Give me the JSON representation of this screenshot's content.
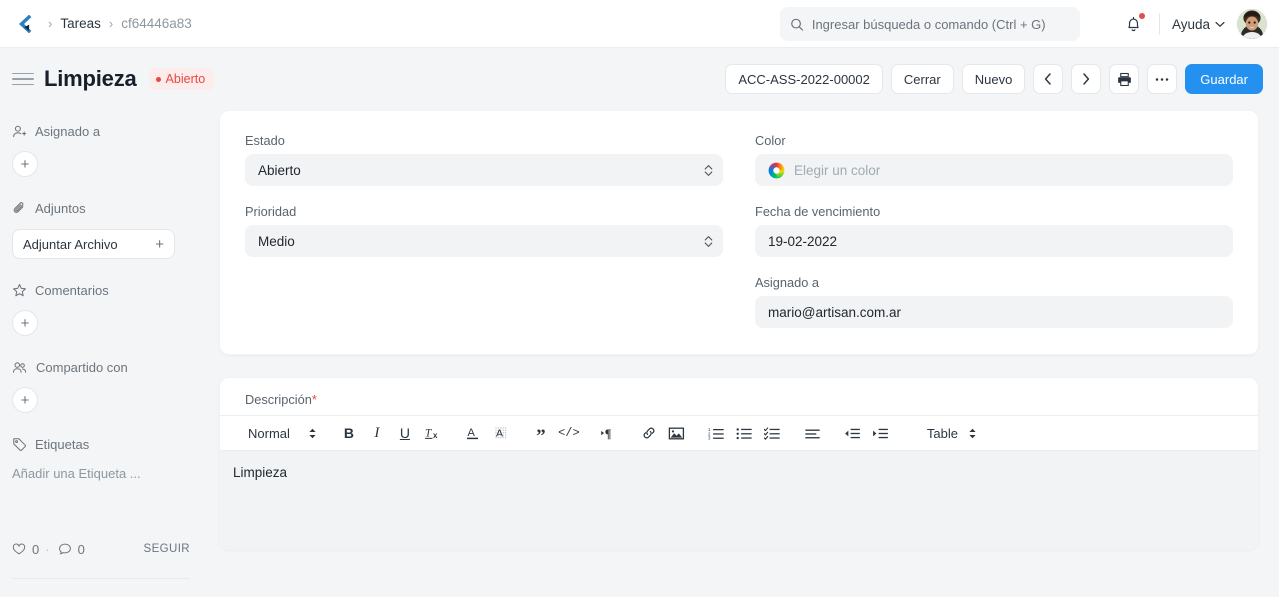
{
  "navbar": {
    "back_icon": "chevron-left-icon",
    "breadcrumbs": [
      {
        "label": "Tareas",
        "muted": false
      },
      {
        "label": "cf64446a83",
        "muted": true
      }
    ],
    "separator": "›",
    "search": {
      "icon": "search-icon",
      "placeholder": "Ingresar búsqueda o comando (Ctrl + G)",
      "value": ""
    },
    "notifications": {
      "icon": "bell-icon",
      "has_unread": true,
      "dot_color": "#e24c4c"
    },
    "help": {
      "label": "Ayuda",
      "icon": "chevron-down-icon"
    },
    "avatar": {
      "icon": "user-avatar"
    }
  },
  "page_header": {
    "menu_icon": "hamburger-icon",
    "title": "Limpieza",
    "status": {
      "label": "Abierto",
      "color": "#e8493f",
      "bg": "#fdecec"
    },
    "actions": {
      "doc_id": "ACC-ASS-2022-00002",
      "close_label": "Cerrar",
      "new_label": "Nuevo",
      "prev_icon": "chevron-left-icon",
      "next_icon": "chevron-right-icon",
      "print_icon": "printer-icon",
      "more_icon": "ellipsis-icon",
      "save_label": "Guardar",
      "save_color": "#2490ef"
    }
  },
  "sidebar": {
    "sections": [
      {
        "icon": "user-plus-icon",
        "label": "Asignado a",
        "control": "plus-circle"
      },
      {
        "icon": "paperclip-icon",
        "label": "Adjuntos",
        "control": "attach-button",
        "button_label": "Adjuntar Archivo"
      },
      {
        "icon": "star-icon",
        "label": "Comentarios",
        "control": "plus-circle"
      },
      {
        "icon": "users-icon",
        "label": "Compartido con",
        "control": "plus-circle"
      },
      {
        "icon": "tag-icon",
        "label": "Etiquetas",
        "control": "tag-placeholder",
        "placeholder": "Añadir una Etiqueta ..."
      }
    ],
    "footer": {
      "like_icon": "heart-icon",
      "like_count": "0",
      "separator": "·",
      "comment_icon": "comment-icon",
      "comment_count": "0",
      "follow_label": "SEGUIR"
    }
  },
  "form": {
    "left": [
      {
        "label": "Estado",
        "value": "Abierto",
        "type": "select"
      },
      {
        "label": "Prioridad",
        "value": "Medio",
        "type": "select"
      }
    ],
    "right": [
      {
        "label": "Color",
        "value": "",
        "placeholder": "Elegir un color",
        "type": "color"
      },
      {
        "label": "Fecha de vencimiento",
        "value": "19-02-2022",
        "type": "date"
      },
      {
        "label": "Asignado a",
        "value": "mario@artisan.com.ar",
        "type": "text"
      }
    ]
  },
  "description": {
    "label": "Descripción",
    "required_marker": "*",
    "toolbar": {
      "style_select": "Normal",
      "buttons": [
        {
          "name": "bold-icon",
          "glyph": "B"
        },
        {
          "name": "italic-icon",
          "glyph": "I"
        },
        {
          "name": "underline-icon",
          "glyph": "U"
        },
        {
          "name": "clear-format-icon",
          "glyph": "Tx"
        },
        {
          "name": "font-color-icon",
          "glyph": "A"
        },
        {
          "name": "highlight-color-icon",
          "glyph": "A"
        },
        {
          "name": "blockquote-icon",
          "glyph": "”"
        },
        {
          "name": "code-block-icon",
          "glyph": "</>"
        },
        {
          "name": "text-direction-icon",
          "glyph": "¶"
        },
        {
          "name": "link-icon",
          "glyph": "link"
        },
        {
          "name": "image-icon",
          "glyph": "image"
        },
        {
          "name": "ordered-list-icon",
          "glyph": "1."
        },
        {
          "name": "bullet-list-icon",
          "glyph": "•"
        },
        {
          "name": "checklist-icon",
          "glyph": "✓"
        },
        {
          "name": "align-icon",
          "glyph": "≡"
        },
        {
          "name": "outdent-icon",
          "glyph": "⇤"
        },
        {
          "name": "indent-icon",
          "glyph": "⇥"
        }
      ],
      "table_label": "Table"
    },
    "content": "Limpieza"
  }
}
